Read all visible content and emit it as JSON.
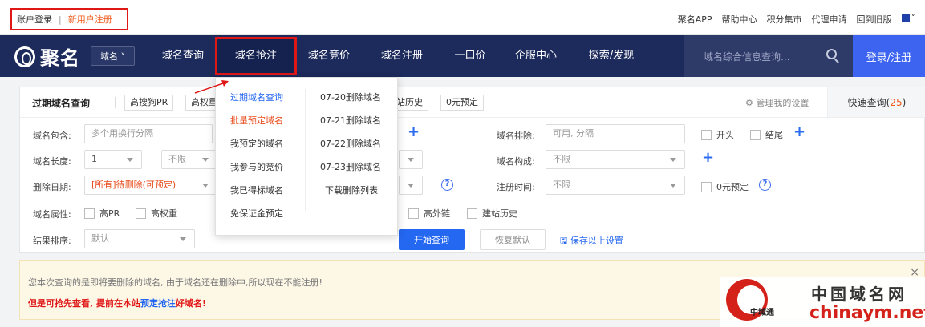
{
  "topbar": {
    "login": "账户登录",
    "separator": "|",
    "register": "新用户注册",
    "links": [
      "聚名APP",
      "帮助中心",
      "积分集市",
      "代理申请",
      "回到旧版"
    ]
  },
  "nav": {
    "logo": "聚名",
    "domain_select": "域名",
    "items": [
      "域名查询",
      "域名抢注",
      "域名竞价",
      "域名注册",
      "一口价",
      "企服中心",
      "探索/发现"
    ],
    "search_placeholder": "域名综合信息查询...",
    "login_button": "登录/注册"
  },
  "panel": {
    "title": "过期域名查询",
    "chips": [
      "高搜狗PR",
      "高权重",
      "站历史",
      "0元预定"
    ],
    "manage": "管理我的设置",
    "quick_label": "快速查询(",
    "quick_count": "25",
    "quick_close": ")",
    "labels": {
      "include": "域名包含:",
      "length": "域名长度:",
      "delete_date": "删除日期:",
      "attribute": "域名属性:",
      "sort": "结果排序:",
      "exclude": "域名排除:",
      "structure": "域名构成:",
      "reg_time": "注册时间:"
    },
    "include_placeholder": "多个用换行分隔",
    "length_from": "1",
    "length_to": "不限",
    "delete_date_value": "[所有]待删除(可预定)",
    "sort_value": "默认",
    "exclude_placeholder": "可用, 分隔",
    "structure_value": "不限",
    "reg_time_value": "不限",
    "checks": {
      "prefix": "开头",
      "suffix": "结尾",
      "zero_reserve": "0元预定",
      "high_pr": "高PR",
      "high_weight": "高权重",
      "high_outlink": "高外链",
      "site_history": "建站历史"
    },
    "search_button": "开始查询",
    "reset_button": "恢复默认",
    "save_link": "保存以上设置"
  },
  "dropdown": {
    "left": [
      "过期域名查询",
      "批量预定域名",
      "我预定的域名",
      "我参与的竞价",
      "我已得标域名",
      "免保证金预定"
    ],
    "right": [
      "07-20删除域名",
      "07-21删除域名",
      "07-22删除域名",
      "07-23删除域名",
      "下载删除列表"
    ]
  },
  "notice": {
    "line1": "您本次查询的是即将要删除的域名, 由于域名还在删除中,所以现在不能注册!",
    "line2_a": "但是可抢先查看, 提前在本站",
    "line2_link": "预定抢注",
    "line2_b": "好域名!",
    "close": "×"
  },
  "watermark": {
    "cn": "中国域名网",
    "en": "chinaym.net",
    "badge": "中域通"
  }
}
